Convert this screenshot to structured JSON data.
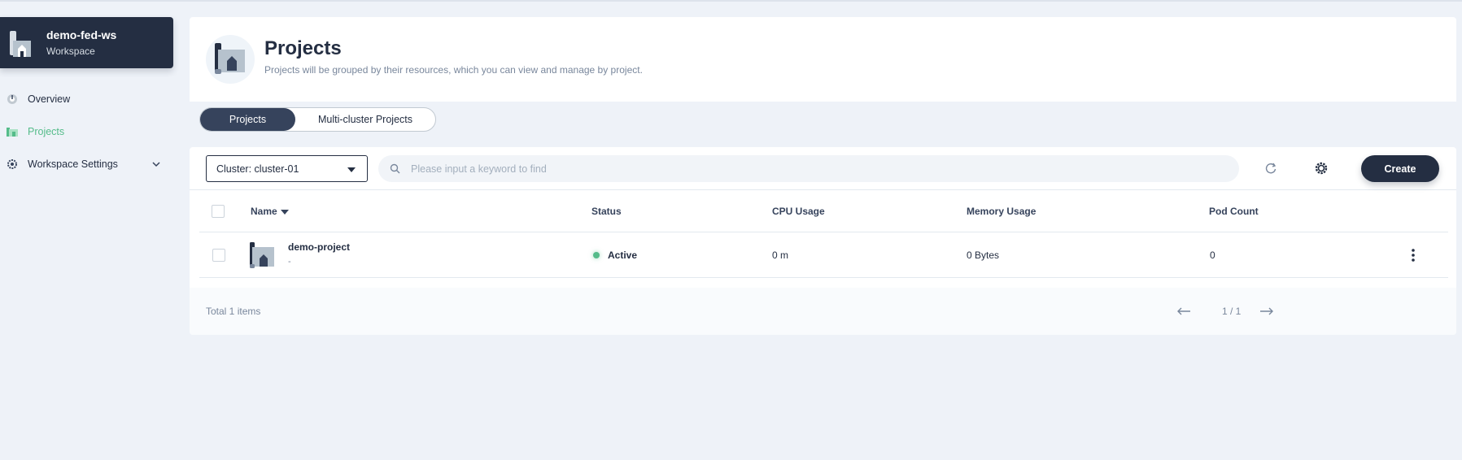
{
  "workspace": {
    "name": "demo-fed-ws",
    "type_label": "Workspace"
  },
  "sidebar": {
    "items": [
      {
        "label": "Overview",
        "icon": "dashboard-icon",
        "active": false
      },
      {
        "label": "Projects",
        "icon": "project-icon",
        "active": true
      },
      {
        "label": "Workspace Settings",
        "icon": "gear-icon",
        "active": false,
        "expandable": true
      }
    ]
  },
  "header": {
    "title": "Projects",
    "description": "Projects will be grouped by their resources, which you can view and manage by project."
  },
  "tabs": [
    {
      "label": "Projects",
      "active": true
    },
    {
      "label": "Multi-cluster Projects",
      "active": false
    }
  ],
  "toolbar": {
    "cluster_select": "Cluster: cluster-01",
    "search_placeholder": "Please input a keyword to find",
    "create_label": "Create"
  },
  "table": {
    "columns": [
      "Name",
      "Status",
      "CPU Usage",
      "Memory Usage",
      "Pod Count"
    ],
    "rows": [
      {
        "name": "demo-project",
        "description": "-",
        "status": "Active",
        "cpu": "0 m",
        "memory": "0 Bytes",
        "pods": "0"
      }
    ]
  },
  "footer": {
    "total": "Total 1 items",
    "page": "1 / 1"
  },
  "colors": {
    "dark": "#242e42",
    "accent_green": "#55bc8a",
    "background": "#eef2f8"
  }
}
